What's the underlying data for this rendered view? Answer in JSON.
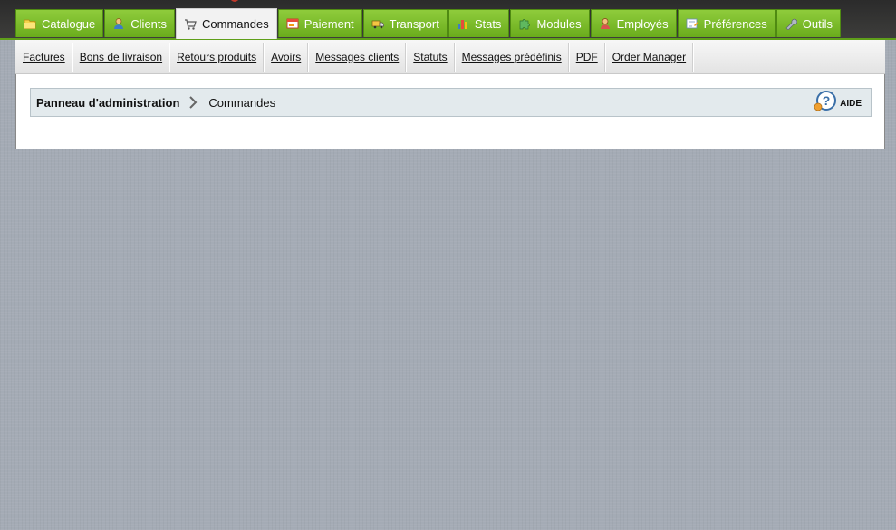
{
  "tabs": [
    {
      "label": "Catalogue",
      "icon": "folder-icon",
      "active": false
    },
    {
      "label": "Clients",
      "icon": "user-icon",
      "active": false
    },
    {
      "label": "Commandes",
      "icon": "cart-icon",
      "active": true
    },
    {
      "label": "Paiement",
      "icon": "payment-icon",
      "active": false
    },
    {
      "label": "Transport",
      "icon": "truck-icon",
      "active": false
    },
    {
      "label": "Stats",
      "icon": "chart-icon",
      "active": false
    },
    {
      "label": "Modules",
      "icon": "puzzle-icon",
      "active": false
    },
    {
      "label": "Employés",
      "icon": "employee-icon",
      "active": false
    },
    {
      "label": "Préférences",
      "icon": "preferences-icon",
      "active": false
    },
    {
      "label": "Outils",
      "icon": "wrench-icon",
      "active": false
    }
  ],
  "subnav": [
    "Factures",
    "Bons de livraison",
    "Retours produits",
    "Avoirs",
    "Messages clients",
    "Statuts",
    "Messages prédéfinis",
    "PDF",
    "Order Manager"
  ],
  "breadcrumb": {
    "root": "Panneau d'administration",
    "current": "Commandes"
  },
  "help": {
    "label": "AIDE",
    "icon": "help-icon"
  },
  "colors": {
    "tab_green": "#7dbd2c",
    "top_bar": "#333333",
    "background": "#a4abb5",
    "breadcrumb_bg": "#e3eaed"
  }
}
